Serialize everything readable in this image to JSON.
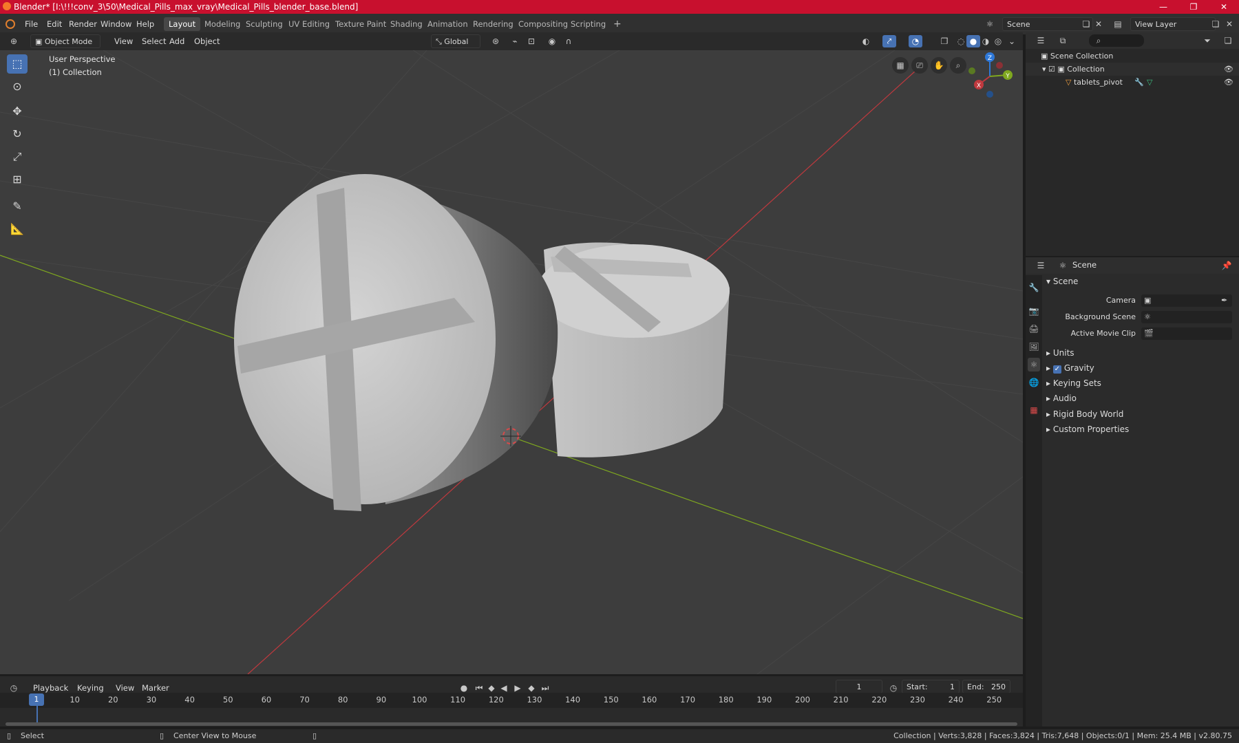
{
  "window": {
    "title": "Blender* [I:\\!!!conv_3\\50\\Medical_Pills_max_vray\\Medical_Pills_blender_base.blend]",
    "controls": [
      "—",
      "❐",
      "✕"
    ]
  },
  "menu": {
    "items": [
      "File",
      "Edit",
      "Render",
      "Window",
      "Help"
    ],
    "workspaces": [
      "Layout",
      "Modeling",
      "Sculpting",
      "UV Editing",
      "Texture Paint",
      "Shading",
      "Animation",
      "Rendering",
      "Compositing",
      "Scripting"
    ],
    "active_workspace": "Layout",
    "add_tab": "+",
    "scene": "Scene",
    "view_layer": "View Layer"
  },
  "viewport_header": {
    "mode": "Object Mode",
    "menus": [
      "View",
      "Select",
      "Add",
      "Object"
    ],
    "orientation": "Global"
  },
  "viewport": {
    "perspective": "User Perspective",
    "collection": "(1) Collection",
    "gizmo_axes": [
      "Z",
      "Y",
      "X"
    ]
  },
  "outliner": {
    "root": "Scene Collection",
    "collection": "Collection",
    "object": "tablets_pivot"
  },
  "properties": {
    "context": "Scene",
    "panel": "Scene",
    "camera_label": "Camera",
    "background_scene_label": "Background Scene",
    "movie_clip_label": "Active Movie Clip",
    "sections": [
      "Units",
      "Gravity",
      "Keying Sets",
      "Audio",
      "Rigid Body World",
      "Custom Properties"
    ],
    "gravity_checked": true
  },
  "timeline": {
    "menus": [
      "Playback",
      "Keying",
      "View",
      "Marker"
    ],
    "current_frame": "1",
    "start_label": "Start:",
    "start": "1",
    "end_label": "End:",
    "end": "250",
    "ticks": [
      "10",
      "20",
      "30",
      "40",
      "50",
      "60",
      "70",
      "80",
      "90",
      "100",
      "110",
      "120",
      "130",
      "140",
      "150",
      "160",
      "170",
      "180",
      "190",
      "200",
      "210",
      "220",
      "230",
      "240",
      "250"
    ],
    "playhead": "1"
  },
  "status": {
    "left": "Select",
    "middle": "Center View to Mouse",
    "right": "Collection | Verts:3,828 | Faces:3,824 | Tris:7,648 | Objects:0/1 | Mem: 25.4 MB | v2.80.75"
  },
  "colors": {
    "titlebar": "#c8102e",
    "accent": "#4772b3",
    "viewport_bg": "#3d3d3d",
    "x_axis": "#c0393e",
    "y_axis": "#7fa81f",
    "z_axis": "#2e78d8"
  }
}
